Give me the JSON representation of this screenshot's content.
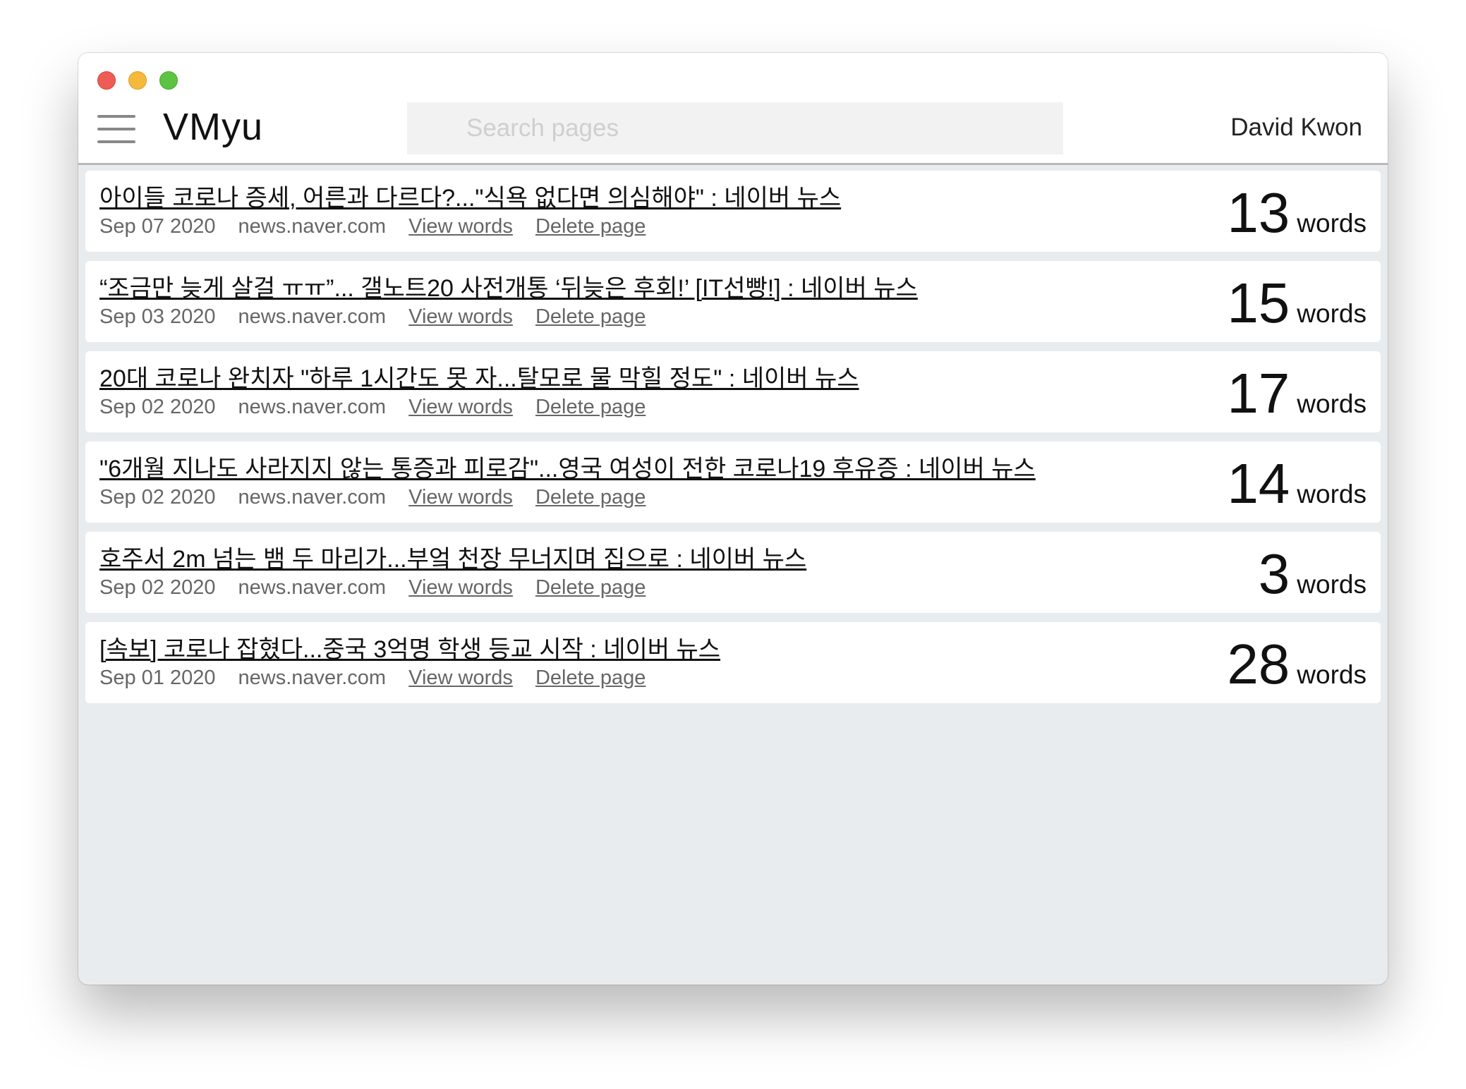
{
  "app": {
    "title": "VMyu",
    "user": "David Kwon",
    "search_placeholder": "Search pages"
  },
  "labels": {
    "view_words": "View words",
    "delete_page": "Delete page",
    "words_unit": "words"
  },
  "pages": [
    {
      "title": "아이들 코로나 증세, 어른과 다르다?...\"식욕 없다면 의심해야\" : 네이버 뉴스",
      "date": "Sep 07 2020",
      "domain": "news.naver.com",
      "count": "13"
    },
    {
      "title": "“조금만 늦게 살걸 ㅠㅠ”... 갤노트20 사전개통 ‘뒤늦은 후회!’ [IT선빵!] : 네이버 뉴스",
      "date": "Sep 03 2020",
      "domain": "news.naver.com",
      "count": "15"
    },
    {
      "title": "20대 코로나 완치자 \"하루 1시간도 못 자...탈모로 물 막힐 정도\" : 네이버 뉴스",
      "date": "Sep 02 2020",
      "domain": "news.naver.com",
      "count": "17"
    },
    {
      "title": "\"6개월 지나도 사라지지 않는 통증과 피로감\"...영국 여성이 전한 코로나19 후유증 : 네이버 뉴스",
      "date": "Sep 02 2020",
      "domain": "news.naver.com",
      "count": "14"
    },
    {
      "title": "호주서 2m 넘는 뱀 두 마리가...부엌 천장 무너지며 집으로 : 네이버 뉴스",
      "date": "Sep 02 2020",
      "domain": "news.naver.com",
      "count": "3"
    },
    {
      "title": "[속보] 코로나 잡혔다...중국 3억명 학생 등교 시작 : 네이버 뉴스",
      "date": "Sep 01 2020",
      "domain": "news.naver.com",
      "count": "28"
    }
  ]
}
